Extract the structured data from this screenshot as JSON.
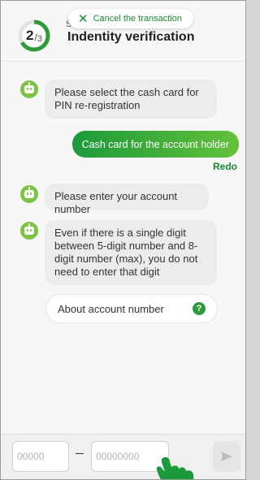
{
  "header": {
    "progress": {
      "current": "2",
      "total": "3",
      "fraction": 0.667
    },
    "step_small": "S",
    "title": "Indentity verification",
    "cancel_label": "Cancel the transaction"
  },
  "chat": {
    "messages": [
      {
        "from": "bot",
        "text": "Please select the cash card for PIN re-registration"
      },
      {
        "from": "user",
        "text": "Cash card for the account holder"
      },
      {
        "from": "bot",
        "text": "Please enter your account number"
      },
      {
        "from": "bot",
        "text": "Even if there is a single digit between 5-digit number and 8-digit number (max), you do not need to enter that digit"
      }
    ],
    "redo_label": "Redo",
    "about_label": "About account number",
    "help_symbol": "?"
  },
  "input": {
    "branch_placeholder": "00000",
    "account_placeholder": "00000000",
    "separator": "–"
  },
  "colors": {
    "accent": "#1a8a2f",
    "accent_light": "#63c13b",
    "bot": "#7cc243",
    "bubble": "#ececec"
  },
  "icons": {
    "cancel": "close-icon",
    "bot": "bot-icon",
    "help": "help-icon",
    "send": "send-icon",
    "pointer": "hand-pointer-icon"
  }
}
